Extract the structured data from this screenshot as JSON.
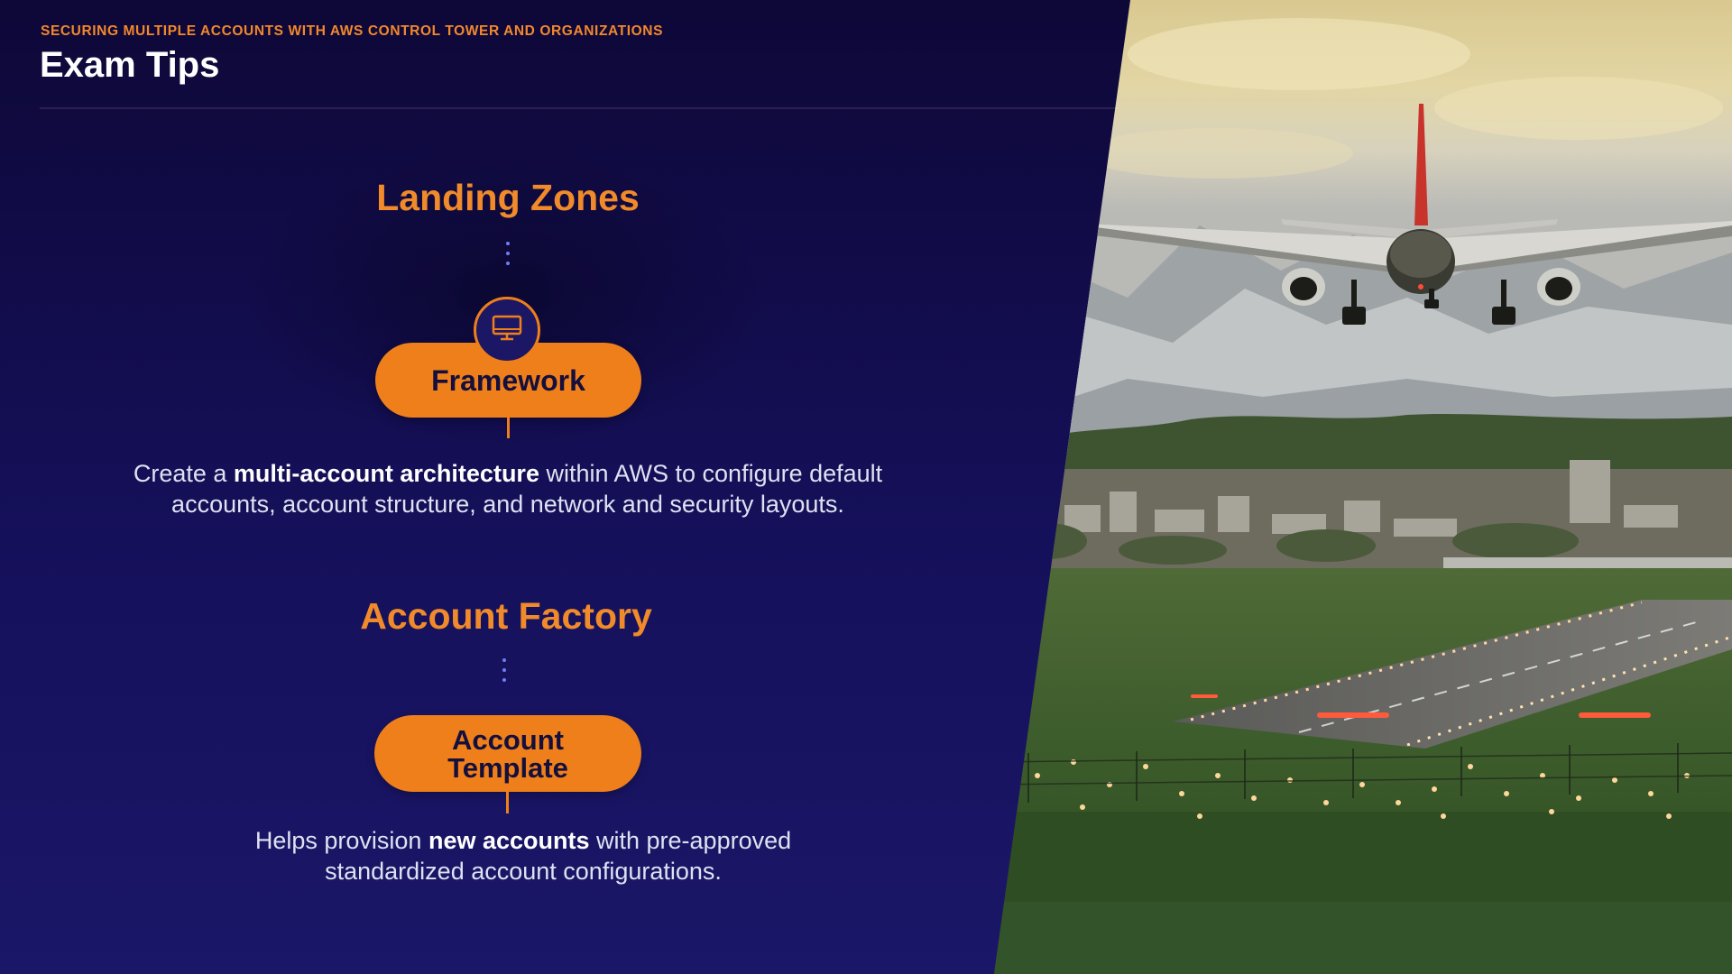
{
  "header": {
    "course_title": "SECURING MULTIPLE ACCOUNTS WITH AWS CONTROL TOWER AND ORGANIZATIONS",
    "slide_title": "Exam Tips"
  },
  "sections": [
    {
      "heading": "Landing Zones",
      "pill_label": "Framework",
      "icon": "desktop-monitor-icon",
      "description": {
        "before": "Create a ",
        "bold": "multi-account architecture",
        "after": " within AWS to configure default accounts, account structure, and network and security layouts."
      }
    },
    {
      "heading": "Account Factory",
      "pill_label_line1": "Account",
      "pill_label_line2": "Template",
      "description": {
        "before": "Helps provision ",
        "bold": "new accounts",
        "after": " with pre-approved standardized account configurations."
      }
    }
  ],
  "photo": {
    "subject": "airplane-landing-photo"
  },
  "colors": {
    "background_top": "#0e0838",
    "background_bottom": "#1b1768",
    "accent_orange": "#ef7f1a",
    "heading_orange": "#f08a2a",
    "dot_blue": "#6c7ff3",
    "text_light": "#dfe1f2",
    "pill_text": "#140f3d"
  }
}
